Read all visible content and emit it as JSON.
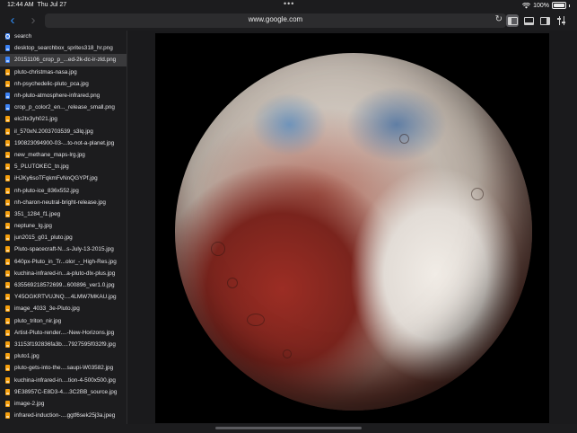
{
  "status_bar": {
    "time": "12:44 AM",
    "date": "Thu Jul 27",
    "battery": "100%"
  },
  "toolbar": {
    "url": "www.google.com"
  },
  "sidebar": {
    "items": [
      {
        "label": "search",
        "type": "search"
      },
      {
        "label": "desktop_searchbox_sprites318_hr.png",
        "type": "blue"
      },
      {
        "label": "20151106_crop_p_...ed-2k-dc-ir-zld.png",
        "type": "blue",
        "selected": true
      },
      {
        "label": "pluto-christmas-nasa.jpg",
        "type": "orange"
      },
      {
        "label": "nh-psychedelic-pluto_pca.jpg",
        "type": "orange"
      },
      {
        "label": "nh-pluto-atmosphere-infrared.png",
        "type": "blue"
      },
      {
        "label": "crop_p_color2_en..._release_small.png",
        "type": "blue"
      },
      {
        "label": "elc2tx3yh021.jpg",
        "type": "orange"
      },
      {
        "label": "il_570xN.2003703539_s3lq.jpg",
        "type": "orange"
      },
      {
        "label": "190823094900-03-...to-not-a-planet.jpg",
        "type": "orange"
      },
      {
        "label": "new_methane_maps-lrg.jpg",
        "type": "orange"
      },
      {
        "label": "5_PLUTOKEC_tn.jpg",
        "type": "orange"
      },
      {
        "label": "iHJKy6soTFqkmFvNnQGYPf.jpg",
        "type": "orange"
      },
      {
        "label": "nh-pluto-ice_836x552.jpg",
        "type": "orange"
      },
      {
        "label": "nh-charon-neutral-bright-release.jpg",
        "type": "orange"
      },
      {
        "label": "351_1284_f1.jpeg",
        "type": "orange"
      },
      {
        "label": "neptune_lg.jpg",
        "type": "orange"
      },
      {
        "label": "jun2015_g01_pluto.jpg",
        "type": "orange"
      },
      {
        "label": "Pluto-spacecraft-N...s-July-13-2015.jpg",
        "type": "orange"
      },
      {
        "label": "640px-Pluto_in_Tr...olor_-_High-Res.jpg",
        "type": "orange"
      },
      {
        "label": "kuchina-infrared-in...a-pluto-dlx-plus.jpg",
        "type": "orange"
      },
      {
        "label": "635569218572699...600896_ver1.0.jpg",
        "type": "orange"
      },
      {
        "label": "Y45OGKRTVUJNQ....4LMW7MKAU.jpg",
        "type": "orange"
      },
      {
        "label": "image_4033_3e-Pluto.jpg",
        "type": "orange"
      },
      {
        "label": "pluto_triton_nir.jpg",
        "type": "orange"
      },
      {
        "label": "Artist-Pluto-render....-New-Horizons.jpg",
        "type": "orange"
      },
      {
        "label": "31153f192836fa3b....7927595f032f9.jpg",
        "type": "orange"
      },
      {
        "label": "pluto1.jpg",
        "type": "orange"
      },
      {
        "label": "pluto-gets-into-the....saupi-W03582.jpg",
        "type": "orange"
      },
      {
        "label": "kuchina-infrared-in....tion-4-500x500.jpg",
        "type": "orange"
      },
      {
        "label": "9E38957C-E8D3-4....3C2BB_source.jpg",
        "type": "orange"
      },
      {
        "label": "image-2.jpg",
        "type": "orange"
      },
      {
        "label": "infrared-induction-....ggtf6sek25j3a.jpeg",
        "type": "orange"
      }
    ]
  },
  "colors": {
    "accent": "#2f8cf4",
    "background": "#1c1c1e",
    "selected_row": "#3a3a3c",
    "file_icon_orange": "#f59e0b",
    "file_icon_blue": "#3b82f6"
  },
  "icons": {
    "back": "chevron-left-icon",
    "forward": "chevron-right-icon",
    "reload": "reload-icon",
    "sidebar_left": "sidebar-left-icon",
    "panel_bottom": "panel-bottom-icon",
    "sidebar_right": "sidebar-right-icon",
    "settings": "sliders-icon"
  }
}
